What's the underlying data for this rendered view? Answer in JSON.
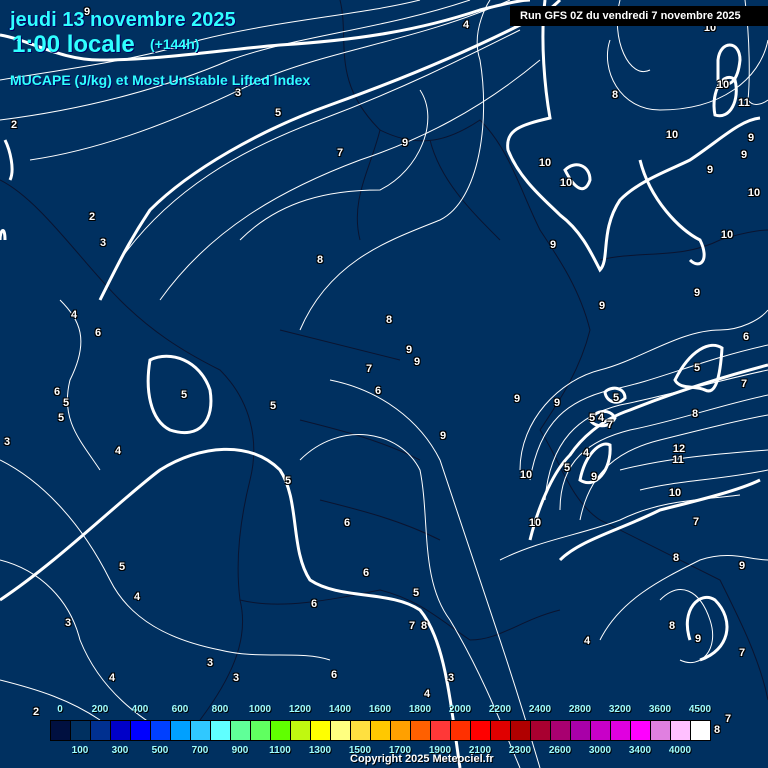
{
  "header": {
    "date": "jeudi 13 novembre 2025",
    "time": "1:00 locale",
    "lead": "(+144h)",
    "parameter": "MUCAPE (J/kg) et Most Unstable Lifted Index",
    "run": "Run GFS 0Z du vendredi 7 novembre 2025"
  },
  "colors": {
    "background": "#003060",
    "contour": "#ffffff",
    "title": "#30ffff"
  },
  "contour_labels": [
    "9",
    "4",
    "10",
    "3",
    "5",
    "2",
    "7",
    "9",
    "8",
    "10",
    "11",
    "10",
    "10",
    "10",
    "9",
    "9",
    "9",
    "10",
    "10",
    "2",
    "3",
    "8",
    "9",
    "4",
    "6",
    "8",
    "9",
    "9",
    "6",
    "9",
    "9",
    "7",
    "5",
    "7",
    "6",
    "5",
    "5",
    "5",
    "6",
    "5",
    "9",
    "9",
    "5",
    "5",
    "4",
    "7",
    "8",
    "9",
    "3",
    "4",
    "4",
    "5",
    "12",
    "11",
    "10",
    "9",
    "5",
    "10",
    "10",
    "7",
    "6",
    "8",
    "9",
    "5",
    "6",
    "4",
    "5",
    "6",
    "3",
    "7",
    "8",
    "8",
    "9",
    "4",
    "7",
    "3",
    "4",
    "3",
    "6",
    "3",
    "4",
    "2",
    "7",
    "8"
  ],
  "legend": {
    "colors": [
      "#001040",
      "#003060",
      "#003090",
      "#0000c8",
      "#0000ff",
      "#0040ff",
      "#00a0ff",
      "#30c8ff",
      "#60ffff",
      "#60ff98",
      "#60ff60",
      "#60ff00",
      "#c0f810",
      "#ffff00",
      "#ffff80",
      "#ffe040",
      "#ffc800",
      "#ffa000",
      "#ff6000",
      "#ff3838",
      "#ff3000",
      "#ff0000",
      "#e00000",
      "#b00000",
      "#a80030",
      "#a80070",
      "#a800a8",
      "#c800c8",
      "#e000e0",
      "#ff00ff",
      "#e080e0",
      "#ffc0ff",
      "#ffffff"
    ],
    "top_labels": [
      "0",
      "200",
      "400",
      "600",
      "800",
      "1000",
      "1200",
      "1400",
      "1600",
      "1800",
      "2000",
      "2200",
      "2400",
      "2800",
      "3200",
      "3600",
      "4500"
    ],
    "bottom_labels": [
      "100",
      "300",
      "500",
      "700",
      "900",
      "1100",
      "1300",
      "1500",
      "1700",
      "1900",
      "2100",
      "2300",
      "2600",
      "3000",
      "3400",
      "4000"
    ]
  },
  "footer": {
    "copyright": "Copyright 2025 Meteociel.fr"
  }
}
